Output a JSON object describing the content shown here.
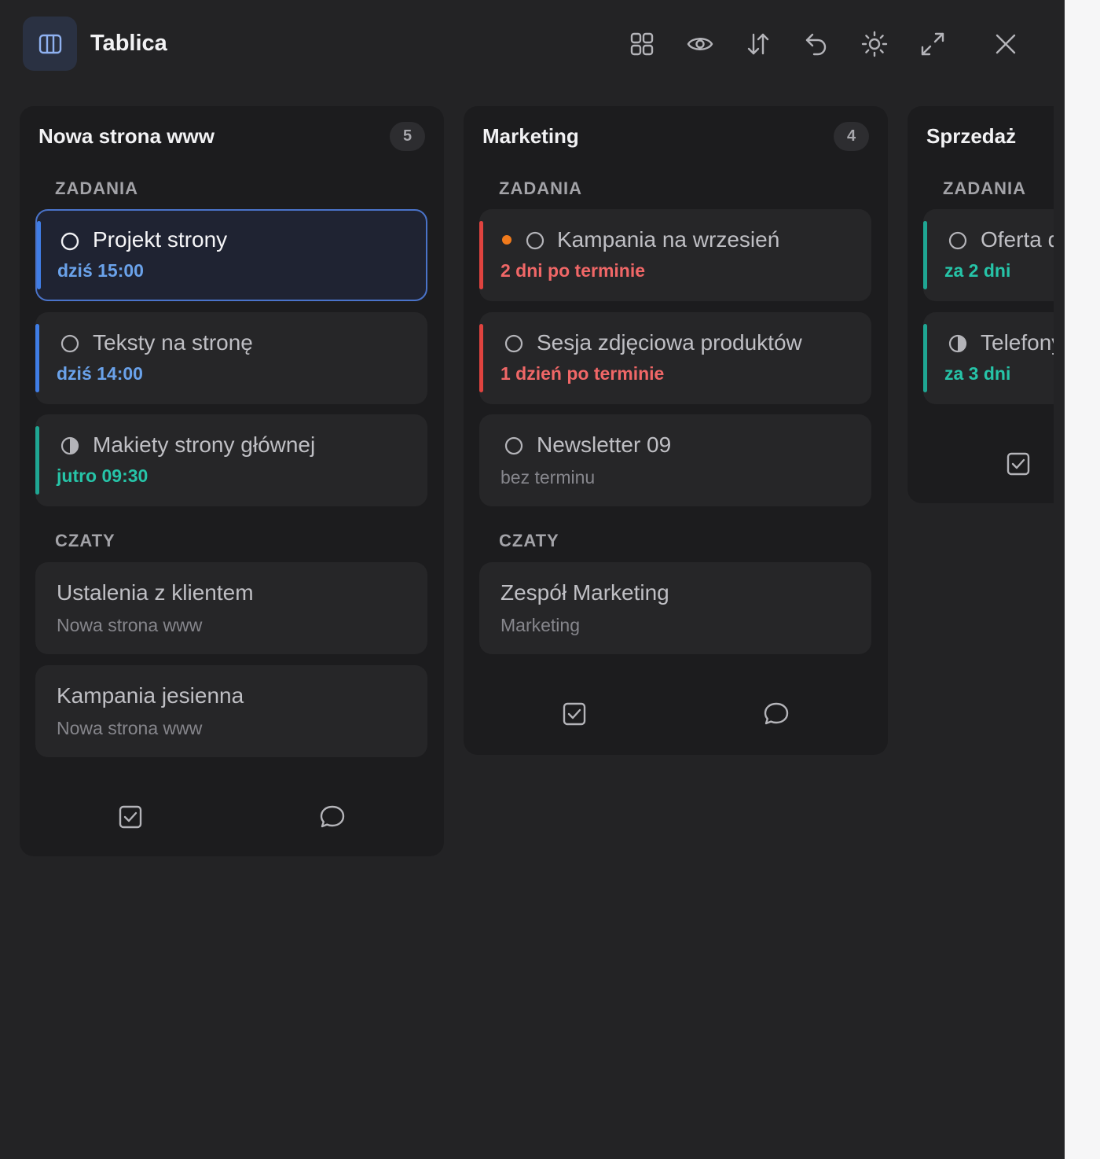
{
  "header": {
    "title": "Tablica",
    "tools": [
      "grid-icon",
      "eye-icon",
      "sort-icon",
      "undo-icon",
      "sun-icon",
      "expand-icon",
      "close-icon"
    ]
  },
  "colors": {
    "panel_bg": "#232325",
    "column_bg": "#1c1c1e",
    "card_bg": "#262628",
    "blue_due": "#6aa2ea",
    "teal_due": "#26c4a8",
    "red_due": "#f06767",
    "blue_bar": "#3f7de6",
    "teal_bar": "#1fa693",
    "red_bar": "#e0433f",
    "orange_dot": "#f07a1c"
  },
  "columns": [
    {
      "title": "Nowa strona www",
      "count": "5",
      "tasks_label": "ZADANIA",
      "chats_label": "CZATY",
      "tasks": [
        {
          "title": "Projekt strony",
          "due": "dziś 15:00",
          "status": "open",
          "selected": true
        },
        {
          "title": "Teksty na stronę",
          "due": "dziś 14:00",
          "status": "open"
        },
        {
          "title": "Makiety strony głównej",
          "due": "jutro 09:30",
          "status": "half"
        }
      ],
      "chats": [
        {
          "title": "Ustalenia z klientem",
          "subtitle": "Nowa strona www"
        },
        {
          "title": "Kampania jesienna",
          "subtitle": "Nowa strona www"
        }
      ]
    },
    {
      "title": "Marketing",
      "count": "4",
      "tasks_label": "ZADANIA",
      "chats_label": "CZATY",
      "tasks": [
        {
          "title": "Kampania na wrzesień",
          "due": "2 dni po terminie",
          "status": "open",
          "flag": "orange-dot"
        },
        {
          "title": "Sesja zdjęciowa produktów",
          "due": "1 dzień po terminie",
          "status": "open"
        },
        {
          "title": "Newsletter 09",
          "due": "bez terminu",
          "status": "open"
        }
      ],
      "chats": [
        {
          "title": "Zespół Marketing",
          "subtitle": "Marketing"
        }
      ]
    },
    {
      "title": "Sprzedaż",
      "tasks_label": "ZADANIA",
      "tasks": [
        {
          "title": "Oferta d",
          "due": "za 2 dni",
          "status": "open"
        },
        {
          "title": "Telefony",
          "due": "za 3 dni",
          "status": "half"
        }
      ]
    }
  ]
}
